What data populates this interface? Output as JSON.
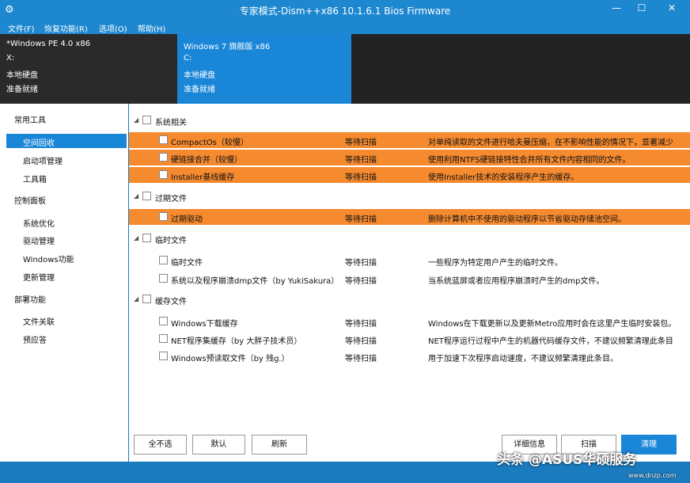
{
  "window": {
    "title": "专家模式-Dism++x86 10.1.6.1 Bios Firmware",
    "minimize": "—",
    "maximize": "☐",
    "close": "✕"
  },
  "menu": [
    "文件(F)",
    "恢复功能(R)",
    "选项(O)",
    "帮助(H)"
  ],
  "volumes": [
    {
      "name": "*Windows PE 4.0 x86",
      "drive": "X:",
      "type": "本地硬盘",
      "status": "准备就绪"
    },
    {
      "name": "Windows 7 旗舰版 x86",
      "drive": "C:",
      "type": "本地硬盘",
      "status": "准备就绪"
    }
  ],
  "sidebar": {
    "groups": [
      {
        "label": "常用工具",
        "items": [
          "空间回收",
          "启动项管理",
          "工具箱"
        ]
      },
      {
        "label": "控制面板",
        "items": [
          "系统优化",
          "驱动管理",
          "Windows功能",
          "更新管理"
        ]
      },
      {
        "label": "部署功能",
        "items": [
          "文件关联",
          "预应答"
        ]
      }
    ],
    "selected": "空间回收"
  },
  "categories": [
    {
      "label": "系统相关",
      "rows": [
        {
          "name": "CompactOs（较慢）",
          "status": "等待扫描",
          "desc": "对单纯读取的文件进行哈夫曼压缩，在不影响性能的情况下，显著减少",
          "highlight": true
        },
        {
          "name": "硬链接合并（较慢）",
          "status": "等待扫描",
          "desc": "使用利用NTFS硬链接特性合并所有文件内容相同的文件。",
          "highlight": true
        },
        {
          "name": "Installer基线缓存",
          "status": "等待扫描",
          "desc": "使用Installer技术的安装程序产生的缓存。",
          "highlight": true
        }
      ]
    },
    {
      "label": "过期文件",
      "rows": [
        {
          "name": "过期驱动",
          "status": "等待扫描",
          "desc": "删除计算机中不使用的驱动程序以节省驱动存储池空间。",
          "highlight": true
        }
      ]
    },
    {
      "label": "临时文件",
      "rows": [
        {
          "name": "临时文件",
          "status": "等待扫描",
          "desc": "一些程序为特定用户产生的临时文件。",
          "highlight": false
        },
        {
          "name": "系统以及程序崩溃dmp文件（by YukiSakura）",
          "status": "等待扫描",
          "desc": "当系统蓝屏或者应用程序崩溃时产生的dmp文件。",
          "highlight": false
        }
      ]
    },
    {
      "label": "缓存文件",
      "rows": [
        {
          "name": "Windows下载缓存",
          "status": "等待扫描",
          "desc": "Windows在下载更新以及更新Metro应用时会在这里产生临时安装包。",
          "highlight": false
        },
        {
          "name": "NET程序集缓存（by 大胖子技术员）",
          "status": "等待扫描",
          "desc": "NET程序运行过程中产生的机器代码缓存文件，不建议频繁清理此条目",
          "highlight": false
        },
        {
          "name": "Windows预读取文件（by 残g.）",
          "status": "等待扫描",
          "desc": "用于加速下次程序启动速度，不建议频繁清理此条目。",
          "highlight": false
        }
      ]
    }
  ],
  "buttons": {
    "select_none": "全不选",
    "default": "默认",
    "refresh": "刷新",
    "details": "详细信息",
    "scan": "扫描",
    "clean": "清理"
  },
  "watermark": {
    "text": "头条 @ASUS华硕服务",
    "site": "www.dnzp.com"
  },
  "colors": {
    "accent": "#1a86d8",
    "highlight": "#f58a2f"
  }
}
